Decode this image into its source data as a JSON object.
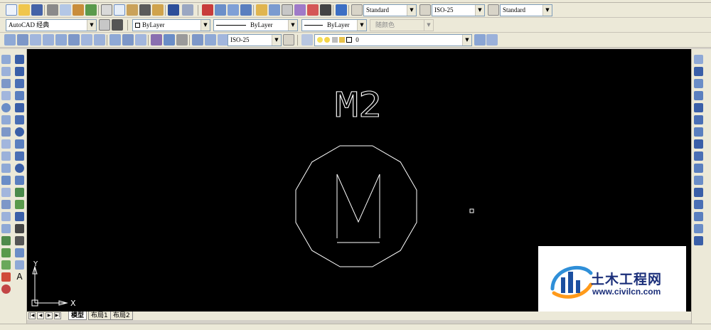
{
  "window": {
    "app": "AutoCAD"
  },
  "toolbar_styles": {
    "text_style": "Standard",
    "dim_style": "ISO-25",
    "table_style": "Standard"
  },
  "workspace": {
    "selected": "AutoCAD 经典"
  },
  "properties_bar": {
    "color": "ByLayer",
    "linetype": "ByLayer",
    "lineweight": "ByLayer",
    "plot_style": "随颜色"
  },
  "dimension_bar": {
    "dim_style": "ISO-25"
  },
  "layer_bar": {
    "current_layer": "0"
  },
  "drawing": {
    "label": "M2",
    "symbol_letter": "M",
    "ucs_x": "X",
    "ucs_y": "Y"
  },
  "layout_tabs": [
    "模型",
    "布局1",
    "布局2"
  ],
  "watermark": {
    "title": "土木工程网",
    "url": "www.civilcn.com"
  },
  "colors": {
    "canvas_bg": "#000000",
    "line_color": "#ffffff",
    "toolbar_bg": "#ece9d8",
    "watermark_blue": "#1b2f7a"
  }
}
